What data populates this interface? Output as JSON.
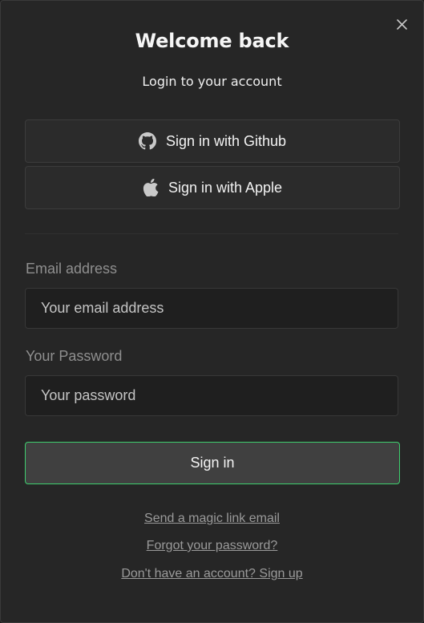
{
  "dialog": {
    "title": "Welcome back",
    "subtitle": "Login to your account",
    "close_icon": "close-icon"
  },
  "oauth": {
    "github": {
      "label": "Sign in with Github",
      "icon": "github-icon"
    },
    "apple": {
      "label": "Sign in with Apple",
      "icon": "apple-icon"
    }
  },
  "form": {
    "email": {
      "label": "Email address",
      "placeholder": "Your email address",
      "value": ""
    },
    "password": {
      "label": "Your Password",
      "placeholder": "Your password",
      "value": ""
    },
    "submit_label": "Sign in"
  },
  "links": {
    "magic_link": "Send a magic link email",
    "forgot_password": "Forgot your password?",
    "sign_up": "Don't have an account? Sign up"
  },
  "colors": {
    "background": "#262626",
    "accent": "#3ecf6e",
    "muted_text": "#8f8f8f"
  }
}
